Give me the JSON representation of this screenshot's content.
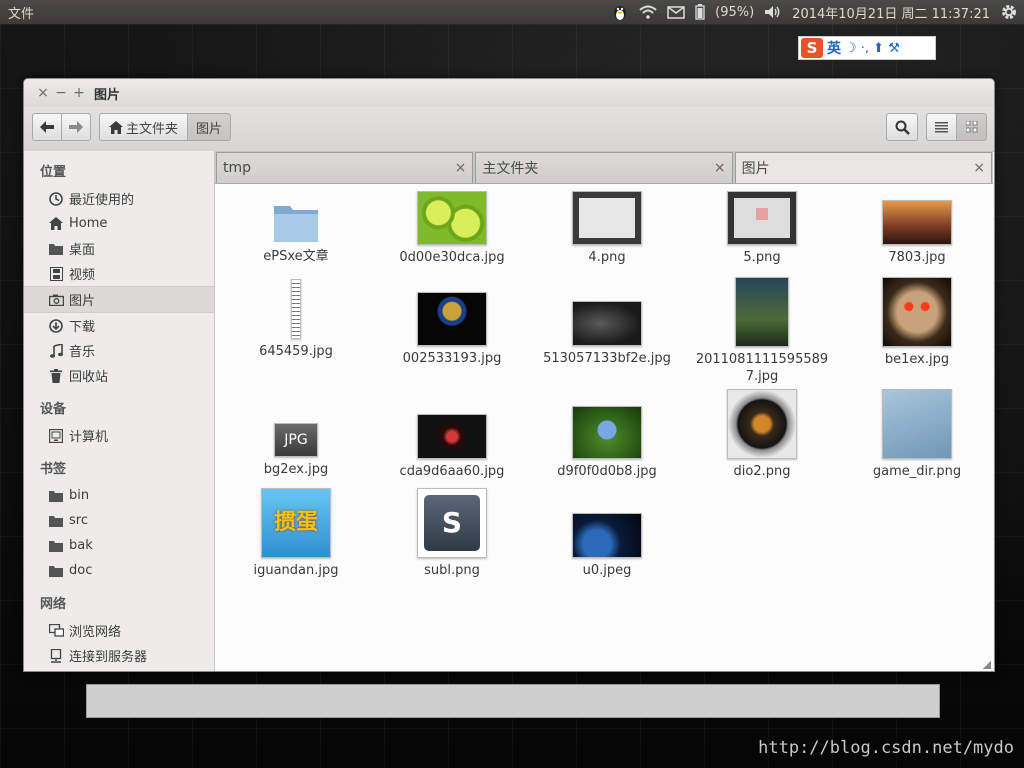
{
  "panel": {
    "app_menu": "文件",
    "battery": "(95%)",
    "clock": "2014年10月21日 周二 11:37:21"
  },
  "ime": {
    "logo": "S",
    "mode": "英",
    "symbols": "☽ ·, ⬆ ⚒"
  },
  "window": {
    "title": "图片",
    "close": "×",
    "minimize": "−",
    "maximize": "+"
  },
  "toolbar": {
    "breadcrumb_home": "主文件夹",
    "breadcrumb_current": "图片"
  },
  "sidebar": {
    "places_header": "位置",
    "places": [
      {
        "label": "最近使用的",
        "icon": "clock-icon"
      },
      {
        "label": "Home",
        "icon": "home-icon"
      },
      {
        "label": "桌面",
        "icon": "folder-icon"
      },
      {
        "label": "视频",
        "icon": "film-icon"
      },
      {
        "label": "图片",
        "icon": "camera-icon"
      },
      {
        "label": "下载",
        "icon": "download-icon"
      },
      {
        "label": "音乐",
        "icon": "music-icon"
      },
      {
        "label": "回收站",
        "icon": "trash-icon"
      }
    ],
    "devices_header": "设备",
    "devices": [
      {
        "label": "计算机",
        "icon": "computer-icon"
      }
    ],
    "bookmarks_header": "书签",
    "bookmarks": [
      {
        "label": "bin",
        "icon": "folder-icon"
      },
      {
        "label": "src",
        "icon": "folder-icon"
      },
      {
        "label": "bak",
        "icon": "folder-icon"
      },
      {
        "label": "doc",
        "icon": "folder-icon"
      }
    ],
    "network_header": "网络",
    "network": [
      {
        "label": "浏览网络",
        "icon": "network-icon"
      },
      {
        "label": "连接到服务器",
        "icon": "server-icon"
      }
    ]
  },
  "tabs": [
    {
      "label": "tmp",
      "close": "×"
    },
    {
      "label": "主文件夹",
      "close": "×"
    },
    {
      "label": "图片",
      "close": "×"
    }
  ],
  "files": [
    {
      "name": "ePSxe文章"
    },
    {
      "name": "0d00e30dca.jpg"
    },
    {
      "name": "4.png"
    },
    {
      "name": "5.png"
    },
    {
      "name": "7803.jpg"
    },
    {
      "name": "645459.jpg"
    },
    {
      "name": "002533193.jpg"
    },
    {
      "name": "513057133bf2e.jpg"
    },
    {
      "name": "20110811115955897.jpg"
    },
    {
      "name": "be1ex.jpg"
    },
    {
      "name": "bg2ex.jpg",
      "thumb_text": "JPG"
    },
    {
      "name": "cda9d6aa60.jpg"
    },
    {
      "name": "d9f0f0d0b8.jpg"
    },
    {
      "name": "dio2.png"
    },
    {
      "name": "game_dir.png"
    },
    {
      "name": "iguandan.jpg",
      "thumb_text": "掼蛋"
    },
    {
      "name": "subl.png",
      "thumb_text": "S"
    },
    {
      "name": "u0.jpeg"
    }
  ],
  "watermark": "http://blog.csdn.net/mydo"
}
